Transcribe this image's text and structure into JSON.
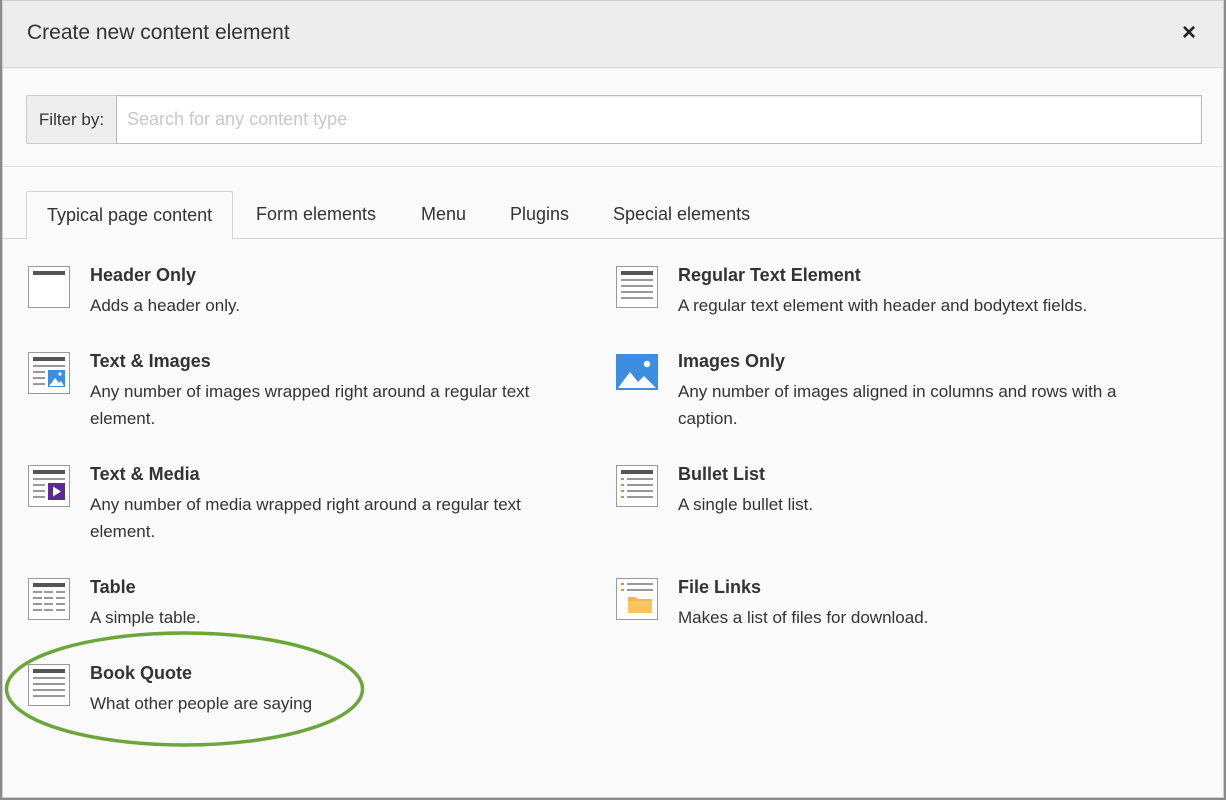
{
  "dialog": {
    "title": "Create new content element",
    "close_label": "×"
  },
  "filter": {
    "label": "Filter by:",
    "placeholder": "Search for any content type",
    "value": ""
  },
  "tabs": [
    {
      "label": "Typical page content",
      "active": true
    },
    {
      "label": "Form elements",
      "active": false
    },
    {
      "label": "Menu",
      "active": false
    },
    {
      "label": "Plugins",
      "active": false
    },
    {
      "label": "Special elements",
      "active": false
    }
  ],
  "items": [
    {
      "name": "Header Only",
      "desc": "Adds a header only.",
      "icon": "header-only-icon"
    },
    {
      "name": "Regular Text Element",
      "desc": "A regular text element with header and bodytext fields.",
      "icon": "text-element-icon"
    },
    {
      "name": "Text & Images",
      "desc": "Any number of images wrapped right around a regular text element.",
      "icon": "text-images-icon"
    },
    {
      "name": "Images Only",
      "desc": "Any number of images aligned in columns and rows with a caption.",
      "icon": "images-only-icon"
    },
    {
      "name": "Text & Media",
      "desc": "Any number of media wrapped right around a regular text element.",
      "icon": "text-media-icon"
    },
    {
      "name": "Bullet List",
      "desc": "A single bullet list.",
      "icon": "bullet-list-icon"
    },
    {
      "name": "Table",
      "desc": "A simple table.",
      "icon": "table-icon"
    },
    {
      "name": "File Links",
      "desc": "Makes a list of files for download.",
      "icon": "file-links-icon"
    },
    {
      "name": "Book Quote",
      "desc": "What other people are saying",
      "icon": "book-quote-icon"
    }
  ],
  "colors": {
    "highlight_ring": "#6aa63a",
    "image_blue": "#3d8ee0",
    "media_purple": "#5b2c8f",
    "bullet_orange": "#e8892a",
    "folder_yellow": "#f0b84a"
  }
}
